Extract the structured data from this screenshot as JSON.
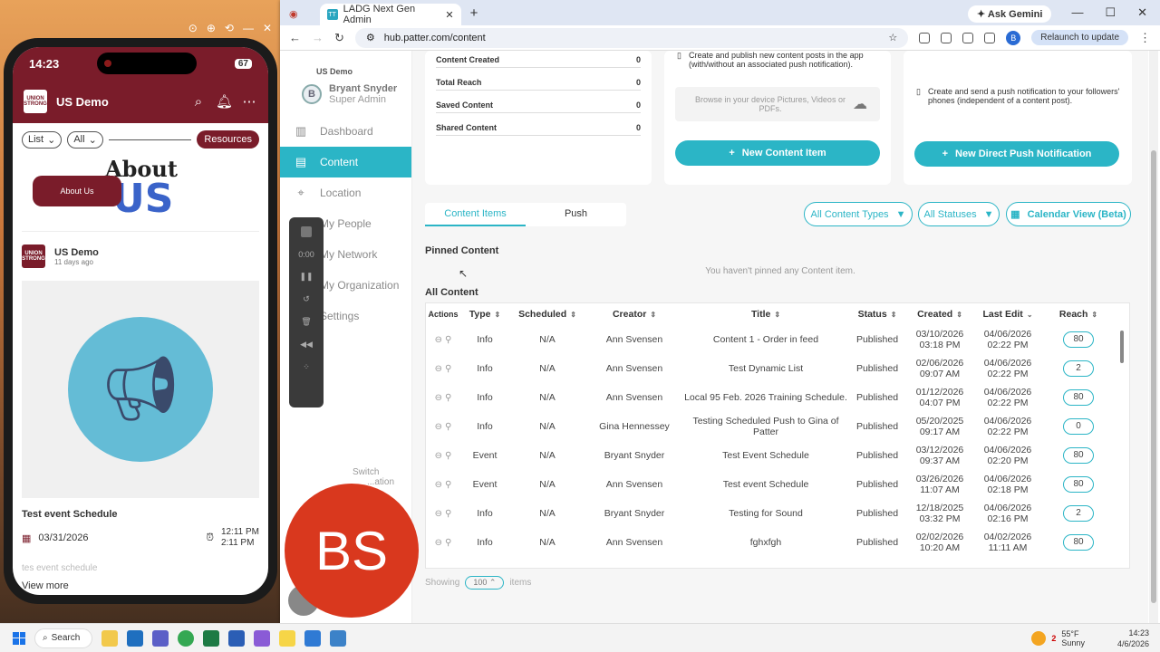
{
  "mirror": {
    "controls": [
      "⊙",
      "⊕",
      "⟲",
      "—",
      "✕"
    ]
  },
  "phone": {
    "time": "14:23",
    "battery": "67",
    "app_title": "US Demo",
    "filters": {
      "view": "List",
      "all": "All",
      "resources": "Resources"
    },
    "about": {
      "title": "About",
      "us": "US",
      "button": "About Us"
    },
    "post": {
      "org": "US Demo",
      "ago": "11 days ago"
    },
    "event": {
      "title": "Test event Schedule",
      "date": "03/31/2026",
      "start": "12:11 PM",
      "end": "2:11 PM",
      "desc": "tes event schedule",
      "view_more": "View more"
    }
  },
  "browser": {
    "tab_title": "LADG Next Gen Admin",
    "ask": "Ask Gemini",
    "url": "hub.patter.com/content",
    "relaunch": "Relaunch to update"
  },
  "sidebar": {
    "brand": "US Demo",
    "user_initial": "B",
    "user_name": "Bryant Snyder",
    "user_role": "Super Admin",
    "items": [
      {
        "label": "Dashboard",
        "icon": "▥"
      },
      {
        "label": "Content",
        "icon": "▤"
      },
      {
        "label": "Location",
        "icon": "⌖"
      },
      {
        "label": "My People",
        "icon": "☺"
      },
      {
        "label": "My Network",
        "icon": "⌘"
      },
      {
        "label": "My Organization",
        "icon": "▦"
      },
      {
        "label": "Settings",
        "icon": "⚙"
      }
    ],
    "switch": "Switch",
    "switch2": "...ation"
  },
  "recorder": {
    "time": "0:00"
  },
  "badge": "BS",
  "stats": [
    {
      "label": "Content Created",
      "value": "0"
    },
    {
      "label": "Total Reach",
      "value": "0"
    },
    {
      "label": "Saved Content",
      "value": "0"
    },
    {
      "label": "Shared Content",
      "value": "0"
    }
  ],
  "content_card": {
    "desc": "Create and publish new content posts in the app (with/without an associated push notification).",
    "drop": "Browse in your device Pictures, Videos or PDFs.",
    "button": "New Content Item"
  },
  "push_card": {
    "desc": "Create and send a push notification to your followers' phones (independent of a content post).",
    "button": "New Direct Push Notification"
  },
  "tabs": {
    "items": "Content Items",
    "push": "Push"
  },
  "filters": {
    "types": "All Content Types",
    "statuses": "All Statuses",
    "calendar": "Calendar View (Beta)"
  },
  "pinned": {
    "title": "Pinned Content",
    "empty": "You haven't pinned any Content item."
  },
  "all_title": "All Content",
  "columns": [
    "Actions",
    "Type",
    "Scheduled",
    "Creator",
    "Title",
    "Status",
    "Created",
    "Last Edit",
    "Reach"
  ],
  "rows": [
    {
      "type": "Info",
      "scheduled": "N/A",
      "creator": "Ann Svensen",
      "title": "Content 1 - Order in feed",
      "status": "Published",
      "created": "03/10/2026",
      "created_t": "03:18 PM",
      "edit": "04/06/2026",
      "edit_t": "02:22 PM",
      "reach": "80"
    },
    {
      "type": "Info",
      "scheduled": "N/A",
      "creator": "Ann Svensen",
      "title": "Test Dynamic List",
      "status": "Published",
      "created": "02/06/2026",
      "created_t": "09:07 AM",
      "edit": "04/06/2026",
      "edit_t": "02:22 PM",
      "reach": "2"
    },
    {
      "type": "Info",
      "scheduled": "N/A",
      "creator": "Ann Svensen",
      "title": "Local 95 Feb. 2026 Training Schedule.",
      "status": "Published",
      "created": "01/12/2026",
      "created_t": "04:07 PM",
      "edit": "04/06/2026",
      "edit_t": "02:22 PM",
      "reach": "80"
    },
    {
      "type": "Info",
      "scheduled": "N/A",
      "creator": "Gina Hennessey",
      "title": "Testing Scheduled Push to Gina of Patter",
      "status": "Published",
      "created": "05/20/2025",
      "created_t": "09:17 AM",
      "edit": "04/06/2026",
      "edit_t": "02:22 PM",
      "reach": "0"
    },
    {
      "type": "Event",
      "scheduled": "N/A",
      "creator": "Bryant Snyder",
      "title": "Test Event Schedule",
      "status": "Published",
      "created": "03/12/2026",
      "created_t": "09:37 AM",
      "edit": "04/06/2026",
      "edit_t": "02:20 PM",
      "reach": "80"
    },
    {
      "type": "Event",
      "scheduled": "N/A",
      "creator": "Ann Svensen",
      "title": "Test event Schedule",
      "status": "Published",
      "created": "03/26/2026",
      "created_t": "11:07 AM",
      "edit": "04/06/2026",
      "edit_t": "02:18 PM",
      "reach": "80"
    },
    {
      "type": "Info",
      "scheduled": "N/A",
      "creator": "Bryant Snyder",
      "title": "Testing for Sound",
      "status": "Published",
      "created": "12/18/2025",
      "created_t": "03:32 PM",
      "edit": "04/06/2026",
      "edit_t": "02:16 PM",
      "reach": "2"
    },
    {
      "type": "Info",
      "scheduled": "N/A",
      "creator": "Ann Svensen",
      "title": "fghxfgh",
      "status": "Published",
      "created": "02/02/2026",
      "created_t": "10:20 AM",
      "edit": "04/02/2026",
      "edit_t": "11:11 AM",
      "reach": "80"
    }
  ],
  "showing": {
    "label": "Showing",
    "count": "100",
    "suffix": "items"
  },
  "taskbar": {
    "search": "Search",
    "temp": "55°F",
    "cond": "Sunny",
    "time": "14:23",
    "date": "4/6/2026",
    "weather_badge": "2"
  }
}
